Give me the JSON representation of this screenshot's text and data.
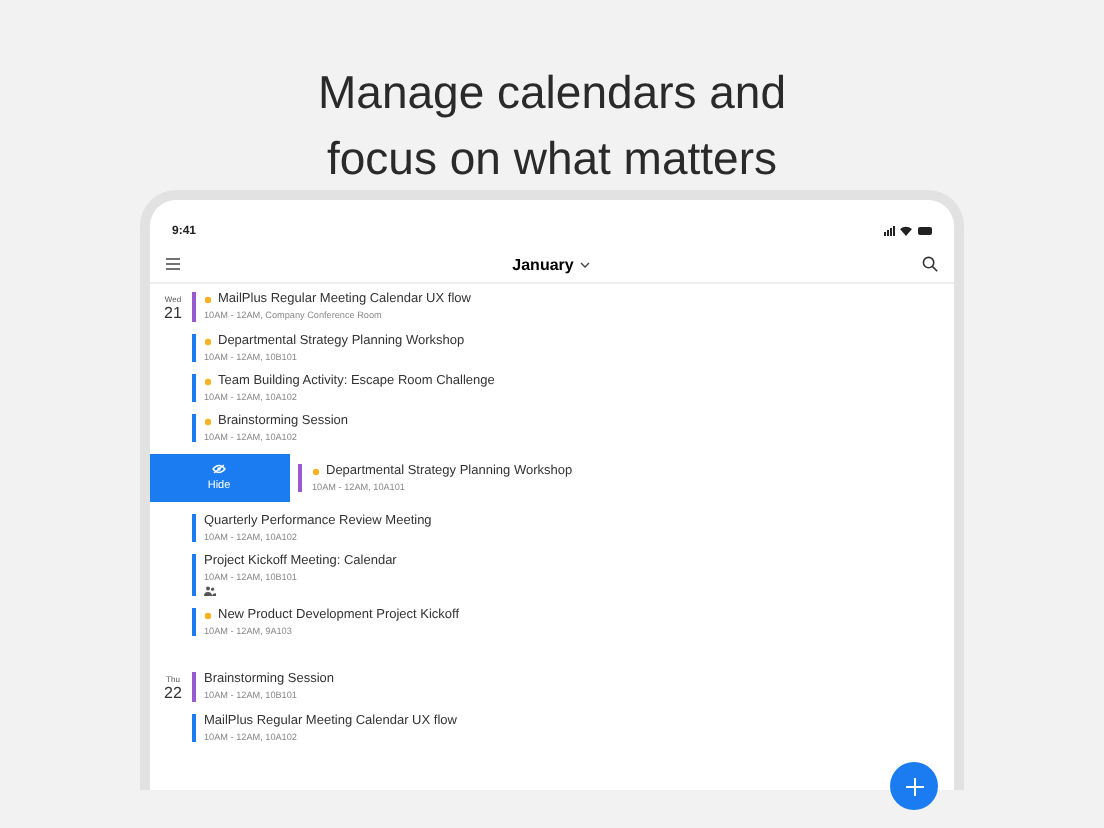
{
  "headline": [
    "Manage calendars and",
    "focus on what matters"
  ],
  "status_bar": {
    "time": "9:41"
  },
  "header": {
    "title": "January"
  },
  "days": [
    {
      "weekday": "Wed",
      "day": "21",
      "events": [
        {
          "title": "MailPlus Regular Meeting Calendar UX flow",
          "details": "10AM - 12AM,  Company Conference Room",
          "starred": true,
          "color": "#9b59d0",
          "swiped": false,
          "shared": false
        },
        {
          "title": "Departmental Strategy Planning Workshop",
          "details": "10AM - 12AM, 10B101",
          "starred": true,
          "color": "#1a7cf0",
          "swiped": false,
          "shared": false
        },
        {
          "title": "Team Building Activity: Escape Room Challenge",
          "details": "10AM - 12AM, 10A102",
          "starred": true,
          "color": "#1a7cf0",
          "swiped": false,
          "shared": false
        },
        {
          "title": "Brainstorming Session",
          "details": "10AM - 12AM, 10A102",
          "starred": true,
          "color": "#1a7cf0",
          "swiped": false,
          "shared": false
        },
        {
          "title": "Departmental Strategy Planning Workshop",
          "details": "10AM - 12AM,  10A101",
          "starred": true,
          "color": "#9b59d0",
          "swiped": true,
          "action": "Hide",
          "shared": false
        },
        {
          "title": "Quarterly Performance Review Meeting",
          "details": "10AM - 12AM, 10A102",
          "starred": false,
          "color": "#1a7cf0",
          "swiped": false,
          "shared": false
        },
        {
          "title": "Project Kickoff Meeting: Calendar",
          "details": "10AM - 12AM, 10B101",
          "starred": false,
          "color": "#1a7cf0",
          "swiped": false,
          "shared": true
        },
        {
          "title": "New Product Development Project Kickoff",
          "details": "10AM - 12AM, 9A103",
          "starred": true,
          "color": "#1a7cf0",
          "swiped": false,
          "shared": false
        }
      ]
    },
    {
      "weekday": "Thu",
      "day": "22",
      "events": [
        {
          "title": "Brainstorming Session",
          "details": "10AM - 12AM, 10B101",
          "starred": false,
          "color": "#9b59d0",
          "swiped": false,
          "shared": false
        },
        {
          "title": "MailPlus Regular Meeting Calendar UX flow",
          "details": "10AM - 12AM, 10A102",
          "starred": false,
          "color": "#1a7cf0",
          "swiped": false,
          "shared": false
        }
      ]
    }
  ]
}
